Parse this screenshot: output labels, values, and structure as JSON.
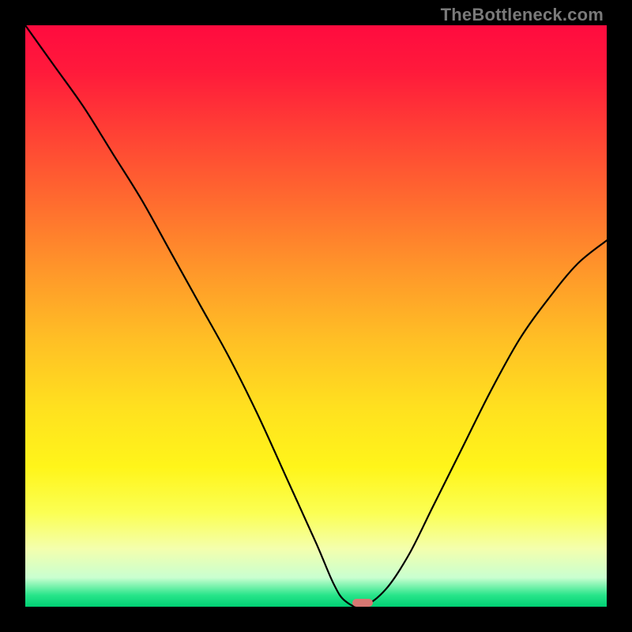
{
  "watermark": "TheBottleneck.com",
  "chart_data": {
    "type": "line",
    "title": "",
    "xlabel": "",
    "ylabel": "",
    "xlim": [
      0,
      100
    ],
    "ylim": [
      0,
      100
    ],
    "grid": false,
    "legend": null,
    "series": [
      {
        "name": "bottleneck-curve",
        "x": [
          0,
          5,
          10,
          15,
          20,
          25,
          30,
          35,
          40,
          45,
          50,
          53,
          55,
          58,
          62,
          66,
          70,
          75,
          80,
          85,
          90,
          95,
          100
        ],
        "y": [
          100,
          93,
          86,
          78,
          70,
          61,
          52,
          43,
          33,
          22,
          11,
          4,
          1,
          0,
          3,
          9,
          17,
          27,
          37,
          46,
          53,
          59,
          63
        ]
      }
    ],
    "minimum_marker": {
      "x": 58,
      "y": 0
    },
    "background_gradient": {
      "top_color": "#ff0b3f",
      "bottom_color": "#00d074"
    }
  }
}
